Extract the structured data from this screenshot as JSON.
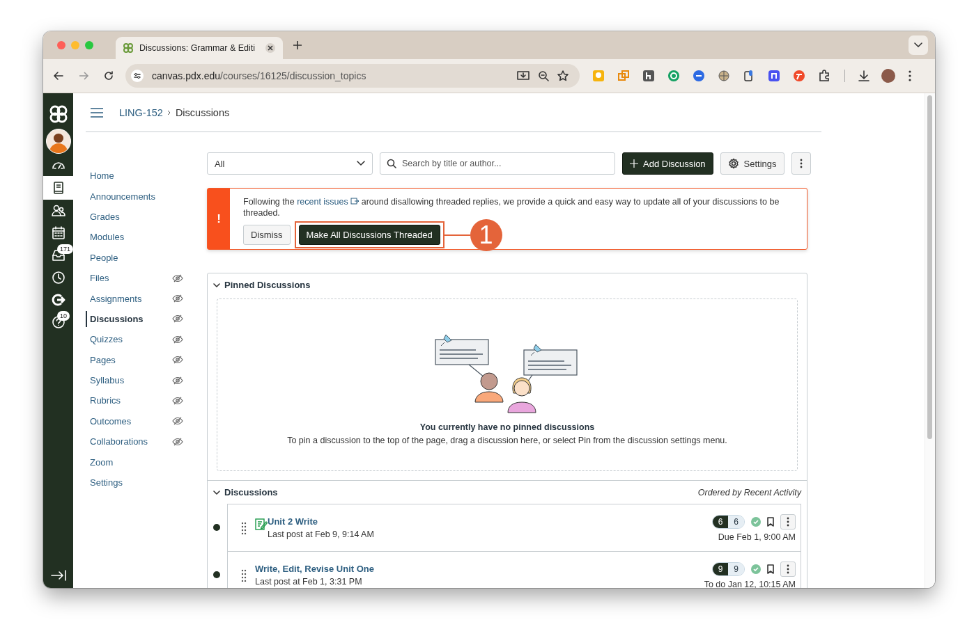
{
  "browser": {
    "tab_title": "Discussions: Grammar & Editi",
    "url": {
      "host": "canvas.pdx.edu",
      "path": "/courses/16125/discussion_topics"
    }
  },
  "global_nav": [
    {
      "kind": "dashboard",
      "selected": false
    },
    {
      "kind": "courses",
      "selected": true
    },
    {
      "kind": "groups",
      "selected": false
    },
    {
      "kind": "calendar",
      "selected": false
    },
    {
      "kind": "inbox",
      "selected": false,
      "badge": "171"
    },
    {
      "kind": "history",
      "selected": false
    },
    {
      "kind": "commons",
      "selected": false
    },
    {
      "kind": "help",
      "selected": false,
      "badge": "10"
    }
  ],
  "breadcrumb": [
    "LING-152",
    "Discussions"
  ],
  "course_nav": [
    {
      "label": "Home",
      "selected": false,
      "hidden": false
    },
    {
      "label": "Announcements",
      "selected": false,
      "hidden": false
    },
    {
      "label": "Grades",
      "selected": false,
      "hidden": false
    },
    {
      "label": "Modules",
      "selected": false,
      "hidden": false
    },
    {
      "label": "People",
      "selected": false,
      "hidden": false
    },
    {
      "label": "Files",
      "selected": false,
      "hidden": true
    },
    {
      "label": "Assignments",
      "selected": false,
      "hidden": true
    },
    {
      "label": "Discussions",
      "selected": true,
      "hidden": true
    },
    {
      "label": "Quizzes",
      "selected": false,
      "hidden": true
    },
    {
      "label": "Pages",
      "selected": false,
      "hidden": true
    },
    {
      "label": "Syllabus",
      "selected": false,
      "hidden": true
    },
    {
      "label": "Rubrics",
      "selected": false,
      "hidden": true
    },
    {
      "label": "Outcomes",
      "selected": false,
      "hidden": true
    },
    {
      "label": "Collaborations",
      "selected": false,
      "hidden": true
    },
    {
      "label": "Zoom",
      "selected": false,
      "hidden": false
    },
    {
      "label": "Settings",
      "selected": false,
      "hidden": false
    }
  ],
  "toolbar": {
    "filter": "All",
    "search_placeholder": "Search by title or author...",
    "add_button": "Add Discussion",
    "settings_button": "Settings"
  },
  "alert": {
    "icon": "!",
    "text_before": "Following the ",
    "link": "recent issues",
    "text_after": " around disallowing threaded replies, we provide a quick and easy way to update all of your discussions to be threaded.",
    "dismiss": "Dismiss",
    "action": "Make All Discussions Threaded",
    "callout": "1"
  },
  "pinned": {
    "title": "Pinned Discussions",
    "expanded": true,
    "empty_title": "You currently have no pinned discussions",
    "empty_text": "To pin a discussion to the top of the page, drag a discussion here, or select Pin from the discussion settings menu."
  },
  "discussions": {
    "title": "Discussions",
    "expanded": true,
    "order_note": "Ordered by Recent Activity",
    "items": [
      {
        "title": "Unit 2 Write",
        "last_post": "Last post at Feb 9, 9:14 AM",
        "unread_count": "6",
        "reply_count": "6",
        "date": "Due Feb 1, 9:00 AM",
        "graded": true,
        "unread": true,
        "published": true
      },
      {
        "title": "Write, Edit, Revise Unit One",
        "last_post": "Last post at Feb 1, 3:31 PM",
        "unread_count": "9",
        "reply_count": "9",
        "date": "To do Jan 12, 10:15 AM",
        "graded": false,
        "unread": true,
        "published": true
      }
    ]
  }
}
